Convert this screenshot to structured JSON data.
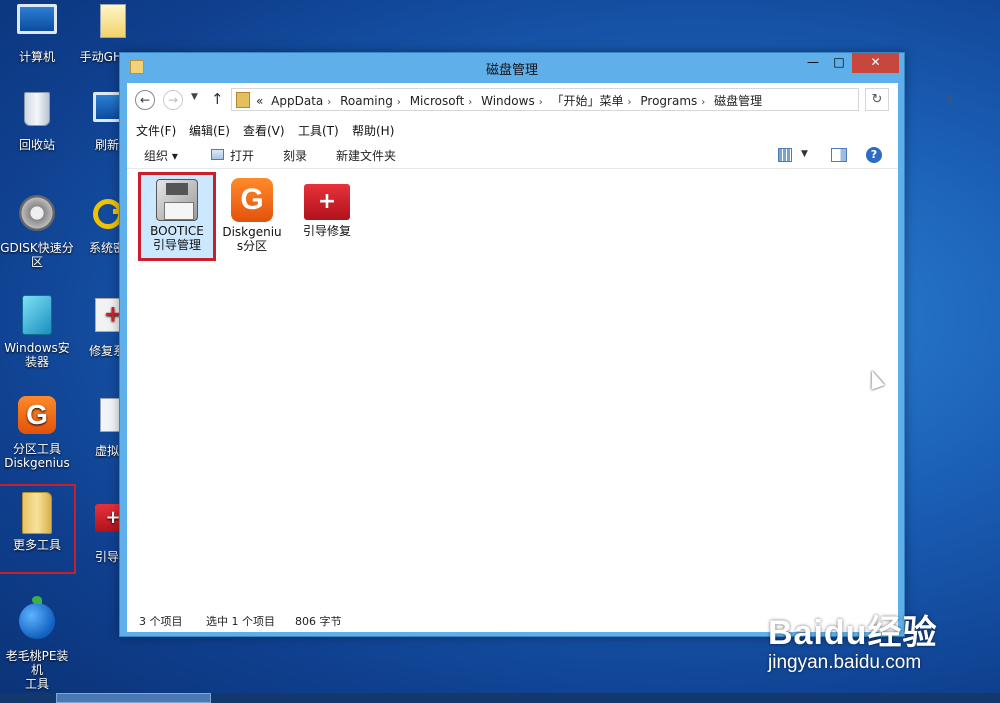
{
  "desktop": {
    "icons": [
      {
        "label": "计算机"
      },
      {
        "label": "手动GHOST"
      },
      {
        "label": "回收站"
      },
      {
        "label": "刷新桌"
      },
      {
        "label": "GDISK快速分\n区"
      },
      {
        "label": "系统密码"
      },
      {
        "label": "Windows安\n装器"
      },
      {
        "label": "修复系统"
      },
      {
        "label": "分区工具\nDiskgenius"
      },
      {
        "label": "虚拟光"
      },
      {
        "label": "更多工具"
      },
      {
        "label": "引导修"
      },
      {
        "label": "老毛桃PE装机\n工具"
      }
    ]
  },
  "window": {
    "title": "磁盘管理",
    "buttons": {
      "minimize": "—",
      "maximize": "□",
      "close": "✕"
    },
    "address": {
      "prefix": "«",
      "crumbs": [
        "AppData",
        "Roaming",
        "Microsoft",
        "Windows",
        "「开始」菜单",
        "Programs",
        "磁盘管理"
      ]
    },
    "menu": [
      "文件(F)",
      "编辑(E)",
      "查看(V)",
      "工具(T)",
      "帮助(H)"
    ],
    "toolbar": {
      "organize": "组织 ▾",
      "open": "打开",
      "burn": "刻录",
      "new_folder": "新建文件夹"
    },
    "files": [
      {
        "label": "BOOTICE\n引导管理",
        "icon": "floppy-icon"
      },
      {
        "label": "Diskgeniu\ns分区",
        "icon": "diskgenius-icon"
      },
      {
        "label": "引导修复",
        "icon": "toolbox-icon"
      }
    ],
    "status": {
      "count": "3 个项目",
      "selected": "选中 1 个项目",
      "size": "806 字节"
    }
  },
  "watermark": {
    "logo": "Baidu经验",
    "url": "jingyan.baidu.com"
  },
  "colors": {
    "accent": "#5fb0ea",
    "highlight": "#c8202a",
    "close": "#c7463d"
  }
}
